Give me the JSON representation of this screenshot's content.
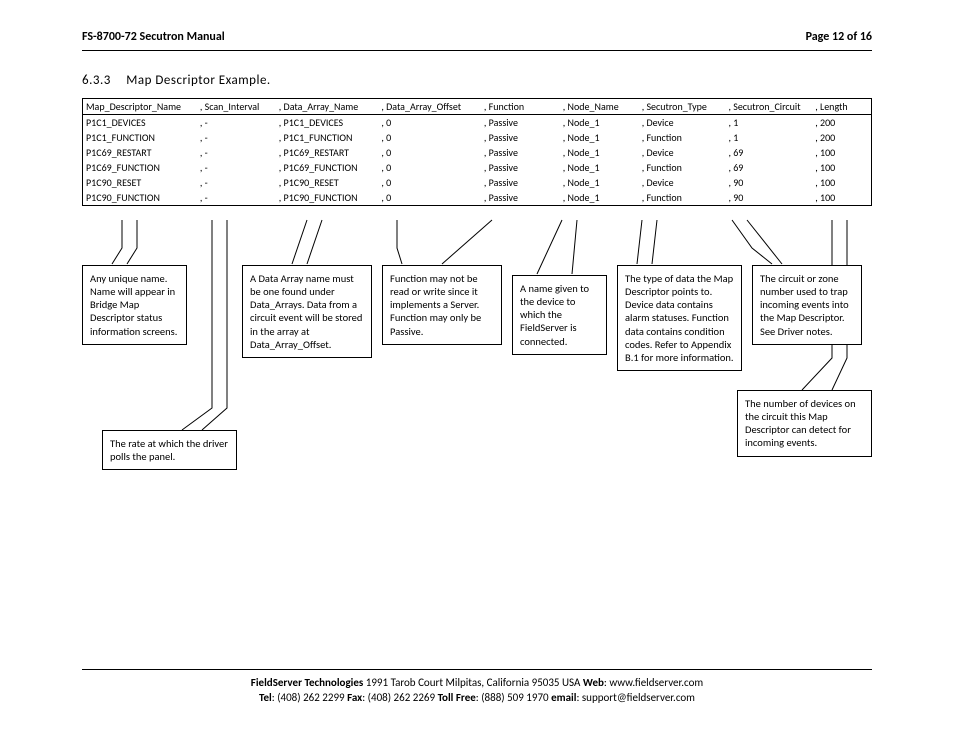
{
  "header": {
    "doc_title": "FS-8700-72 Secutron Manual",
    "page_label": "Page 12 of 16"
  },
  "section": {
    "number": "6.3.3",
    "title": "Map Descriptor Example."
  },
  "table": {
    "headers": [
      "Map_Descriptor_Name",
      ", Scan_Interval",
      ", Data_Array_Name",
      ", Data_Array_Offset",
      ", Function",
      ", Node_Name",
      ", Secutron_Type",
      ", Secutron_Circuit",
      ", Length"
    ],
    "rows": [
      [
        "P1C1_DEVICES",
        ", -",
        ", P1C1_DEVICES",
        ", 0",
        ", Passive",
        ", Node_1",
        ", Device",
        ", 1",
        ", 200"
      ],
      [
        "P1C1_FUNCTION",
        ", -",
        ", P1C1_FUNCTION",
        ", 0",
        ", Passive",
        ", Node_1",
        ", Function",
        ", 1",
        ", 200"
      ],
      [
        "P1C69_RESTART",
        ", -",
        ", P1C69_RESTART",
        ", 0",
        ", Passive",
        ", Node_1",
        ", Device",
        ", 69",
        ", 100"
      ],
      [
        "P1C69_FUNCTION",
        ", -",
        ", P1C69_FUNCTION",
        ", 0",
        ", Passive",
        ", Node_1",
        ", Function",
        ", 69",
        ", 100"
      ],
      [
        "P1C90_RESET",
        ", -",
        ", P1C90_RESET",
        ", 0",
        ", Passive",
        ", Node_1",
        ", Device",
        ", 90",
        ", 100"
      ],
      [
        "P1C90_FUNCTION",
        ", -",
        ", P1C90_FUNCTION",
        ", 0",
        ", Passive",
        ", Node_1",
        ", Function",
        ", 90",
        ", 100"
      ]
    ]
  },
  "callouts": {
    "c1": "Any unique name.  Name will appear in Bridge Map Descriptor status information screens.",
    "c2": "The rate at which the driver polls the panel.",
    "c3": "A Data Array name must be one found under Data_Arrays. Data from a circuit event will be stored in the array at Data_Array_Offset.",
    "c4": "Function may not be read or write since it implements a Server. Function may only be Passive.",
    "c5": "A name given to the device to which the FieldServer is connected.",
    "c6": "The type of data the Map Descriptor points to.  Device data contains alarm statuses. Function data contains condition codes. Refer to Appendix B.1 for more information.",
    "c7": "The circuit or zone number used to trap incoming events into the Map Descriptor. See Driver notes.",
    "c8": "The number of devices on the circuit this Map Descriptor can detect for incoming events."
  },
  "footer": {
    "line1_prefix": "FieldServer Technologies",
    "line1_rest": " 1991 Tarob Court Milpitas, California 95035 USA  ",
    "web_label": "Web",
    "web_value": ": www.fieldserver.com",
    "tel_label": "Tel",
    "tel_value": ": (408) 262 2299  ",
    "fax_label": "Fax",
    "fax_value": ": (408) 262 2269  ",
    "tollfree_label": "Toll Free",
    "tollfree_value": ": (888) 509 1970  ",
    "email_label": "email",
    "email_value": ": support@fieldserver.com"
  }
}
